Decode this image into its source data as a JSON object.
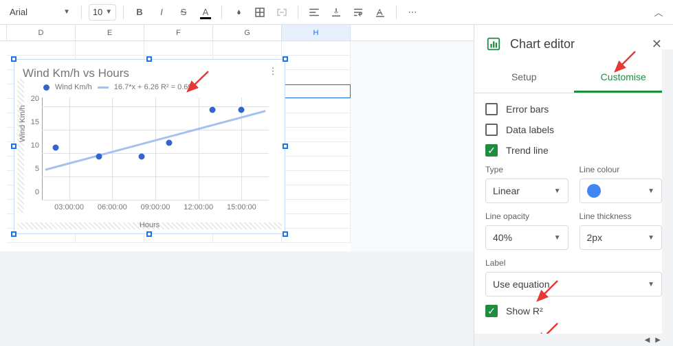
{
  "toolbar": {
    "font": "Arial",
    "size": "10"
  },
  "columns": [
    "D",
    "E",
    "F",
    "G",
    "H"
  ],
  "selected_col": "H",
  "chart": {
    "title": "Wind Km/h vs Hours",
    "legend_series": "Wind Km/h",
    "legend_trend": "16.7*x + 6.26 R² = 0.699",
    "yaxis": "Wind Km/h",
    "xaxis": "Hours",
    "yticks": [
      "0",
      "5",
      "10",
      "15",
      "20"
    ],
    "xticks": [
      "03:00:00",
      "06:00:00",
      "09:00:00",
      "12:00:00",
      "15:00:00"
    ]
  },
  "chart_data": {
    "type": "scatter",
    "title": "Wind Km/h vs Hours",
    "xlabel": "Hours",
    "ylabel": "Wind Km/h",
    "ylim": [
      0,
      22
    ],
    "xticks": [
      "03:00:00",
      "06:00:00",
      "09:00:00",
      "12:00:00",
      "15:00:00"
    ],
    "series": [
      {
        "name": "Wind Km/h",
        "x": [
          "02:00:00",
          "05:00:00",
          "08:00:00",
          "10:00:00",
          "13:00:00",
          "15:00:00"
        ],
        "y": [
          10,
          8,
          8,
          11,
          18,
          18
        ]
      }
    ],
    "trendline": {
      "type": "linear",
      "equation": "16.7*x + 6.26",
      "r2": 0.699
    }
  },
  "panel": {
    "title": "Chart editor",
    "tab_setup": "Setup",
    "tab_customise": "Customise",
    "error_bars": "Error bars",
    "data_labels": "Data labels",
    "trend_line": "Trend line",
    "type_label": "Type",
    "type_value": "Linear",
    "color_label": "Line colour",
    "opacity_label": "Line opacity",
    "opacity_value": "40%",
    "thickness_label": "Line thickness",
    "thickness_value": "2px",
    "label_label": "Label",
    "label_value": "Use equation",
    "show_r2": "Show R²"
  }
}
